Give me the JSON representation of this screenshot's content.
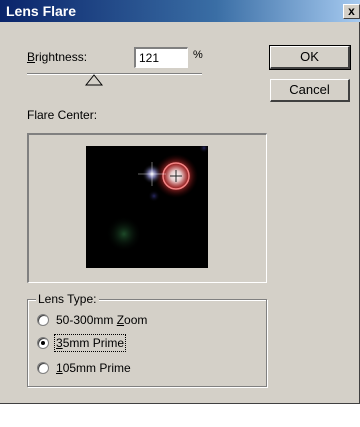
{
  "window": {
    "title": "Lens Flare",
    "close_glyph": "x"
  },
  "brightness": {
    "label_first": "B",
    "label_rest": "rightness:",
    "value": "121",
    "unit": "%",
    "level": 121
  },
  "buttons": {
    "ok": "OK",
    "cancel": "Cancel"
  },
  "flare_center": {
    "label": "Flare Center:"
  },
  "lens_type": {
    "legend": "Lens Type:",
    "options": [
      {
        "mnemonic": "",
        "label_pre": "50-300mm ",
        "label_u": "Z",
        "label_post": "oom",
        "selected": false
      },
      {
        "mnemonic": "3",
        "label_pre": "",
        "label_u": "3",
        "label_post": "5mm Prime",
        "selected": true
      },
      {
        "mnemonic": "1",
        "label_pre": "",
        "label_u": "1",
        "label_post": "05mm Prime",
        "selected": false
      }
    ]
  },
  "colors": {
    "title_start": "#0a246a",
    "title_end": "#a6caf0",
    "face": "#d4d0c8"
  }
}
